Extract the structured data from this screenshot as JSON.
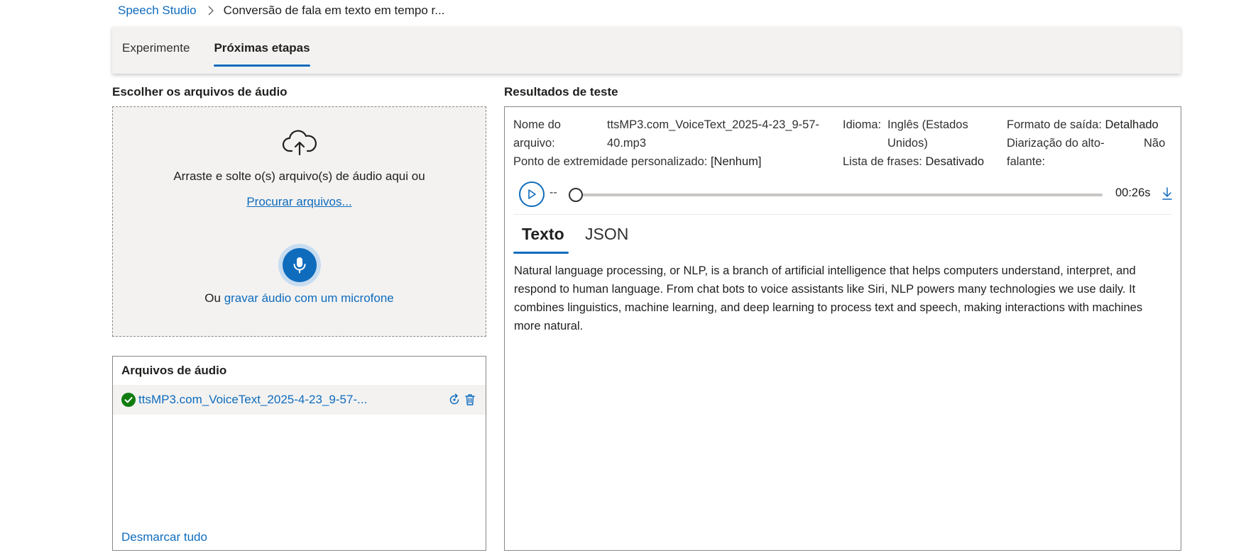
{
  "breadcrumb": {
    "root": "Speech Studio",
    "current": "Conversão de fala em texto em tempo r..."
  },
  "tabs": [
    {
      "label": "Experimente",
      "active": false
    },
    {
      "label": "Próximas etapas",
      "active": true
    }
  ],
  "left": {
    "upload_title": "Escolher os arquivos de áudio",
    "dropzone": {
      "drag_text": "Arraste e solte o(s) arquivo(s) de áudio aqui ou",
      "browse_link": "Procurar arquivos...",
      "record_prefix": "Ou",
      "record_link": "gravar áudio com um microfone"
    },
    "files": {
      "title": "Arquivos de áudio",
      "items": [
        {
          "name": "ttsMP3.com_VoiceText_2025-4-23_9-57-...",
          "status": "success"
        }
      ],
      "uncheck_all": "Desmarcar tudo"
    }
  },
  "results": {
    "title": "Resultados de teste",
    "meta": {
      "file_label": "Nome do arquivo:",
      "file_value": "ttsMP3.com_VoiceText_2025-4-23_9-57-40.mp3",
      "endpoint_label": "Ponto de extremidade personalizado:",
      "endpoint_value": "[Nenhum]",
      "language_label": "Idioma:",
      "language_value": "Inglês (Estados Unidos)",
      "phrase_label": "Lista de frases:",
      "phrase_value": "Desativado",
      "format_label": "Formato de saída:",
      "format_value": "Detalhado",
      "diarization_label": "Diarização do alto-falante:",
      "diarization_value": "Não"
    },
    "player": {
      "position": "--",
      "duration": "00:26s",
      "progress": 0
    },
    "tabs": [
      {
        "label": "Texto",
        "active": true
      },
      {
        "label": "JSON",
        "active": false
      }
    ],
    "transcript": "Natural language processing, or NLP, is a branch of artificial intelligence that helps computers understand, interpret, and respond to human language. From chat bots to voice assistants like Siri, NLP powers many technologies we use daily. It combines linguistics, machine learning, and deep learning to process text and speech, making interactions with machines more natural."
  },
  "colors": {
    "accent": "#0f6cbd",
    "success": "#107c10",
    "panel_bg": "#f3f2f1",
    "border": "#8a8886"
  },
  "icons": [
    "chevron-right-icon",
    "cloud-upload-icon",
    "microphone-icon",
    "checkmark-circle-icon",
    "rerun-icon",
    "delete-icon",
    "play-icon",
    "download-icon"
  ]
}
